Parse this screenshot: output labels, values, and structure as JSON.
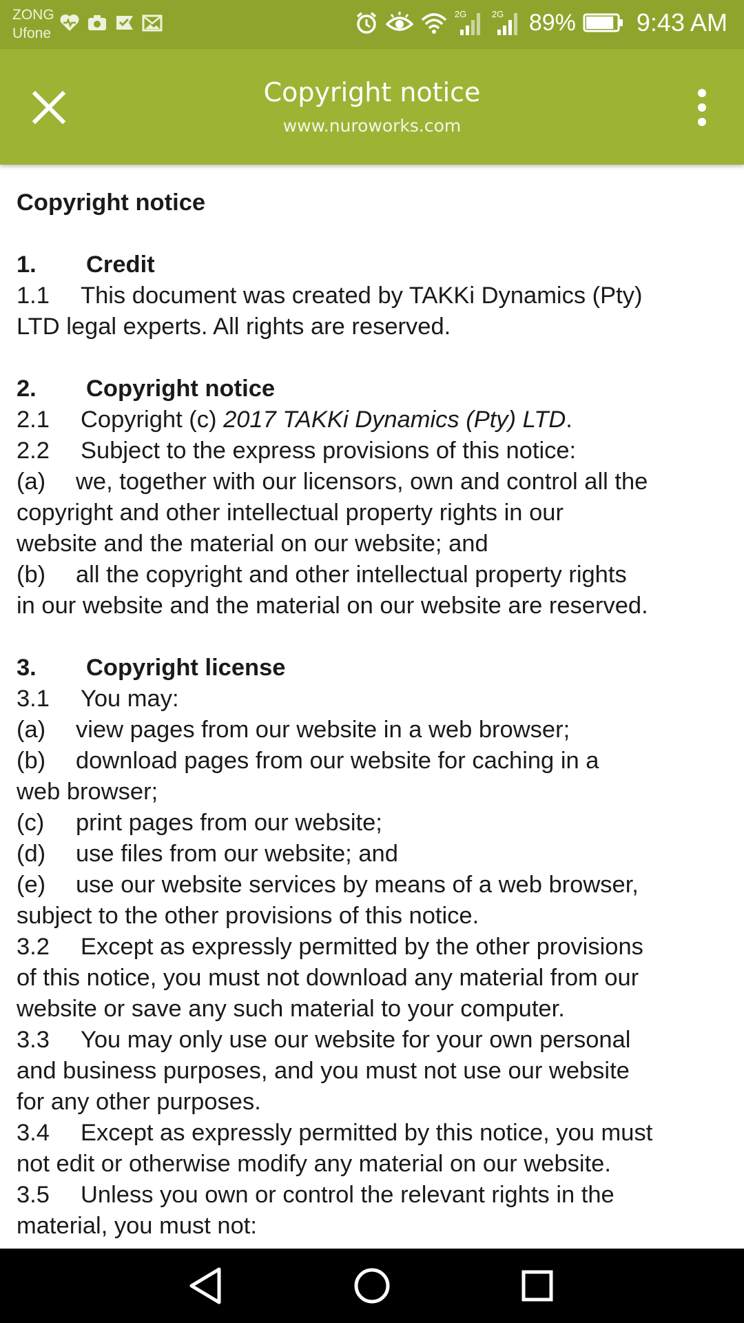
{
  "status_bar": {
    "carrier_1": "ZONG",
    "carrier_2": "Ufone",
    "left_icons": [
      "health-icon",
      "camera-icon",
      "check-flag-icon",
      "mail-image-icon"
    ],
    "right_icons": [
      "alarm-icon",
      "eye-icon",
      "wifi-icon",
      "signal-2g-icon",
      "signal-2g-icon"
    ],
    "network_label_1": "2G",
    "network_label_2": "2G",
    "battery_percent": "89%",
    "battery_level": 0.89,
    "time": "9:43 AM"
  },
  "app_bar": {
    "title": "Copyright notice",
    "url": "www.nuroworks.com",
    "close_icon": "close-icon",
    "menu_icon": "more-vert-icon",
    "color": "#9bb434"
  },
  "document": {
    "title": "Copyright notice",
    "s1": {
      "num": "1.",
      "heading": "Credit",
      "p1_1_num": "1.1",
      "p1_1a": "This document was created by TAKKi Dynamics (Pty)",
      "p1_1b": "LTD legal experts. All rights are reserved."
    },
    "s2": {
      "num": "2.",
      "heading": "Copyright notice",
      "p2_1_num": "2.1",
      "p2_1_text": "Copyright (c) ",
      "p2_1_italic": "2017 TAKKi Dynamics (Pty) LTD",
      "p2_1_end": ".",
      "p2_2_num": "2.2",
      "p2_2": "Subject to the express provisions of this notice:",
      "a_let": "(a)",
      "a1": "we, together with our licensors, own and control all the",
      "a2": "copyright and other intellectual property rights in our",
      "a3": "website and the material on our website; and",
      "b_let": "(b)",
      "b1": "all the copyright and other intellectual property rights",
      "b2": "in our website and the material on our website are reserved."
    },
    "s3": {
      "num": "3.",
      "heading": "Copyright license",
      "p3_1_num": "3.1",
      "p3_1": "You may:",
      "a_let": "(a)",
      "a": "view pages from our website in a web browser;",
      "b_let": "(b)",
      "b1": "download pages from our website for caching in a",
      "b2": "web browser;",
      "c_let": "(c)",
      "c": "print pages from our website;",
      "d_let": "(d)",
      "d": "use files from our website; and",
      "e_let": "(e)",
      "e1": "use our website services by means of a web browser,",
      "e2": "subject to the other provisions of this notice.",
      "p3_2_num": "3.2",
      "p3_2a": "Except as expressly permitted by the other provisions",
      "p3_2b": "of this notice, you must not download any material from our",
      "p3_2c": "website or save any such material to your computer.",
      "p3_3_num": "3.3",
      "p3_3a": "You may only use our website for your own personal",
      "p3_3b": "and business purposes, and you must not use our website",
      "p3_3c": "for any other purposes.",
      "p3_4_num": "3.4",
      "p3_4a": "Except as expressly permitted by this notice, you must",
      "p3_4b": "not edit or otherwise modify any material on our website.",
      "p3_5_num": "3.5",
      "p3_5a": "Unless you own or control the relevant rights in the",
      "p3_5b": "material, you must not:"
    }
  },
  "nav_bar": {
    "back_icon": "back-triangle-icon",
    "home_icon": "home-circle-icon",
    "recents_icon": "recents-square-icon"
  }
}
